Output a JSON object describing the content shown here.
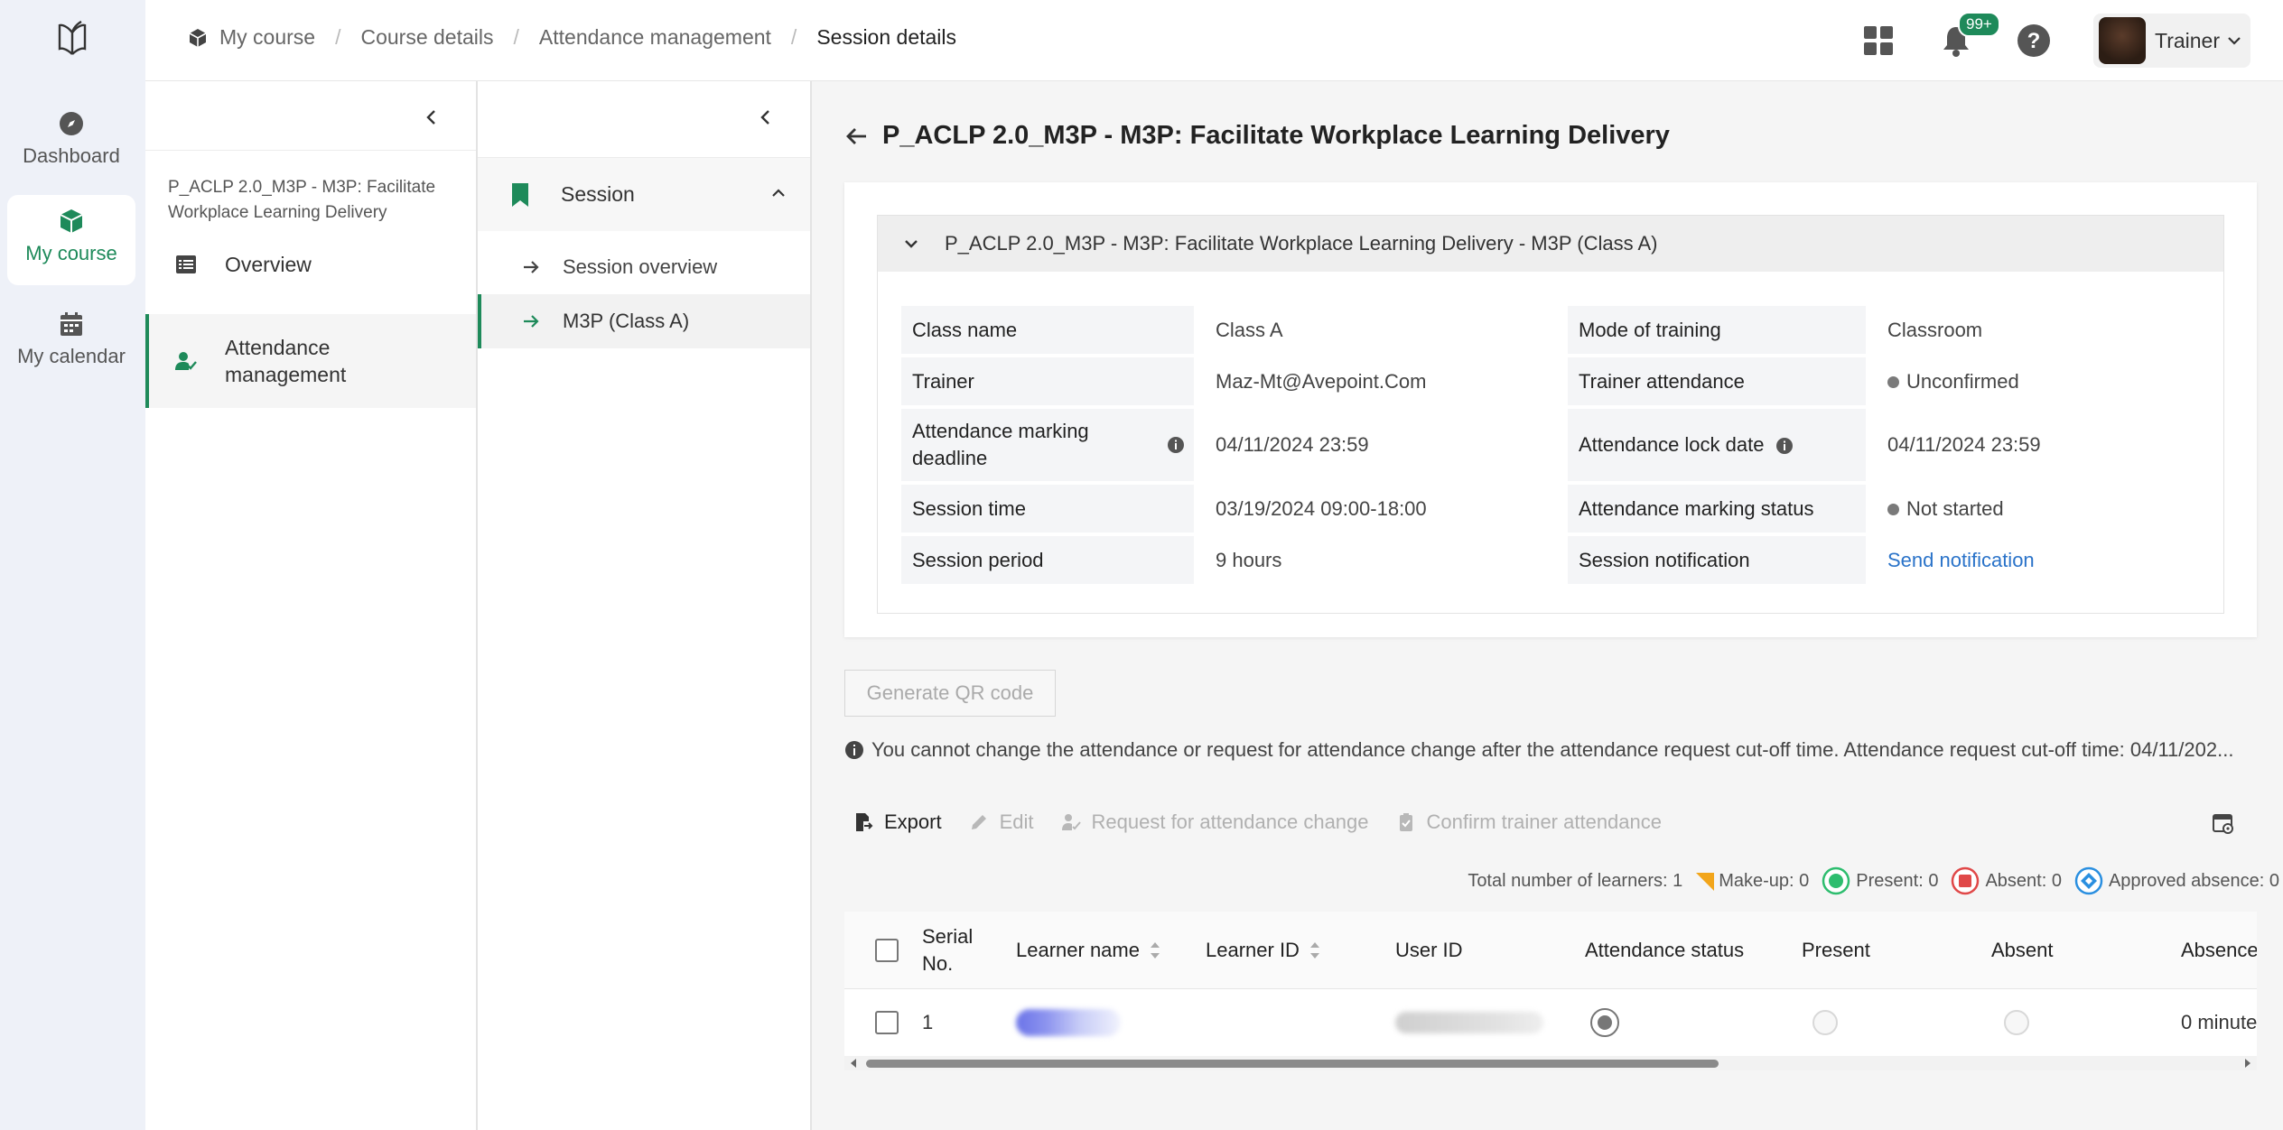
{
  "nav": {
    "items": [
      {
        "label": "Dashboard",
        "icon": "compass-icon"
      },
      {
        "label": "My course",
        "icon": "cube-icon",
        "active": true
      },
      {
        "label": "My calendar",
        "icon": "calendar-icon"
      }
    ]
  },
  "breadcrumb": [
    "My course",
    "Course details",
    "Attendance management",
    "Session details"
  ],
  "header": {
    "notification_badge": "99+",
    "user_role": "Trainer"
  },
  "course_panel": {
    "title": "P_ACLP 2.0_M3P - M3P: Facilitate Workplace Learning Delivery",
    "items": [
      {
        "label": "Overview",
        "icon": "list-icon"
      },
      {
        "label": "Attendance management",
        "icon": "user-check-icon",
        "active": true
      }
    ]
  },
  "session_panel": {
    "section_label": "Session",
    "items": [
      {
        "label": "Session overview"
      },
      {
        "label": "M3P (Class A)",
        "active": true
      }
    ]
  },
  "page": {
    "title": "P_ACLP 2.0_M3P - M3P: Facilitate Workplace Learning Delivery",
    "accordion_title": "P_ACLP 2.0_M3P - M3P: Facilitate Workplace Learning Delivery - M3P (Class A)",
    "details": {
      "class_name_label": "Class name",
      "class_name": "Class A",
      "mode_label": "Mode of training",
      "mode": "Classroom",
      "trainer_label": "Trainer",
      "trainer": "Maz-Mt@Avepoint.Com",
      "trainer_attendance_label": "Trainer attendance",
      "trainer_attendance": "Unconfirmed",
      "deadline_label": "Attendance marking deadline",
      "deadline": "04/11/2024 23:59",
      "lock_date_label": "Attendance lock date",
      "lock_date": "04/11/2024 23:59",
      "session_time_label": "Session time",
      "session_time": "03/19/2024 09:00-18:00",
      "marking_status_label": "Attendance marking status",
      "marking_status": "Not started",
      "session_period_label": "Session period",
      "session_period": "9 hours",
      "notification_label": "Session notification",
      "notification_link": "Send notification"
    },
    "qr_button": "Generate QR code",
    "notice": "You cannot change the attendance or request for attendance change after the attendance request cut-off time. Attendance request cut-off time: 04/11/202..."
  },
  "toolbar": {
    "export": "Export",
    "edit": "Edit",
    "request_change": "Request for attendance change",
    "confirm_trainer": "Confirm trainer attendance"
  },
  "legend": {
    "total": "Total number of learners: 1",
    "makeup": "Make-up: 0",
    "present": "Present: 0",
    "absent": "Absent: 0",
    "approved": "Approved absence: 0"
  },
  "table": {
    "columns": [
      "Serial No.",
      "Learner name",
      "Learner ID",
      "User ID",
      "Attendance status",
      "Present",
      "Absent",
      "Absence"
    ],
    "rows": [
      {
        "serial": "1",
        "absence": "0 minute"
      }
    ]
  },
  "colors": {
    "accent": "#1e8a5a",
    "link": "#2a73c9",
    "present": "#2dbd6e",
    "absent": "#e04848",
    "approved": "#2a8fe0",
    "makeup": "#f2a51a"
  }
}
